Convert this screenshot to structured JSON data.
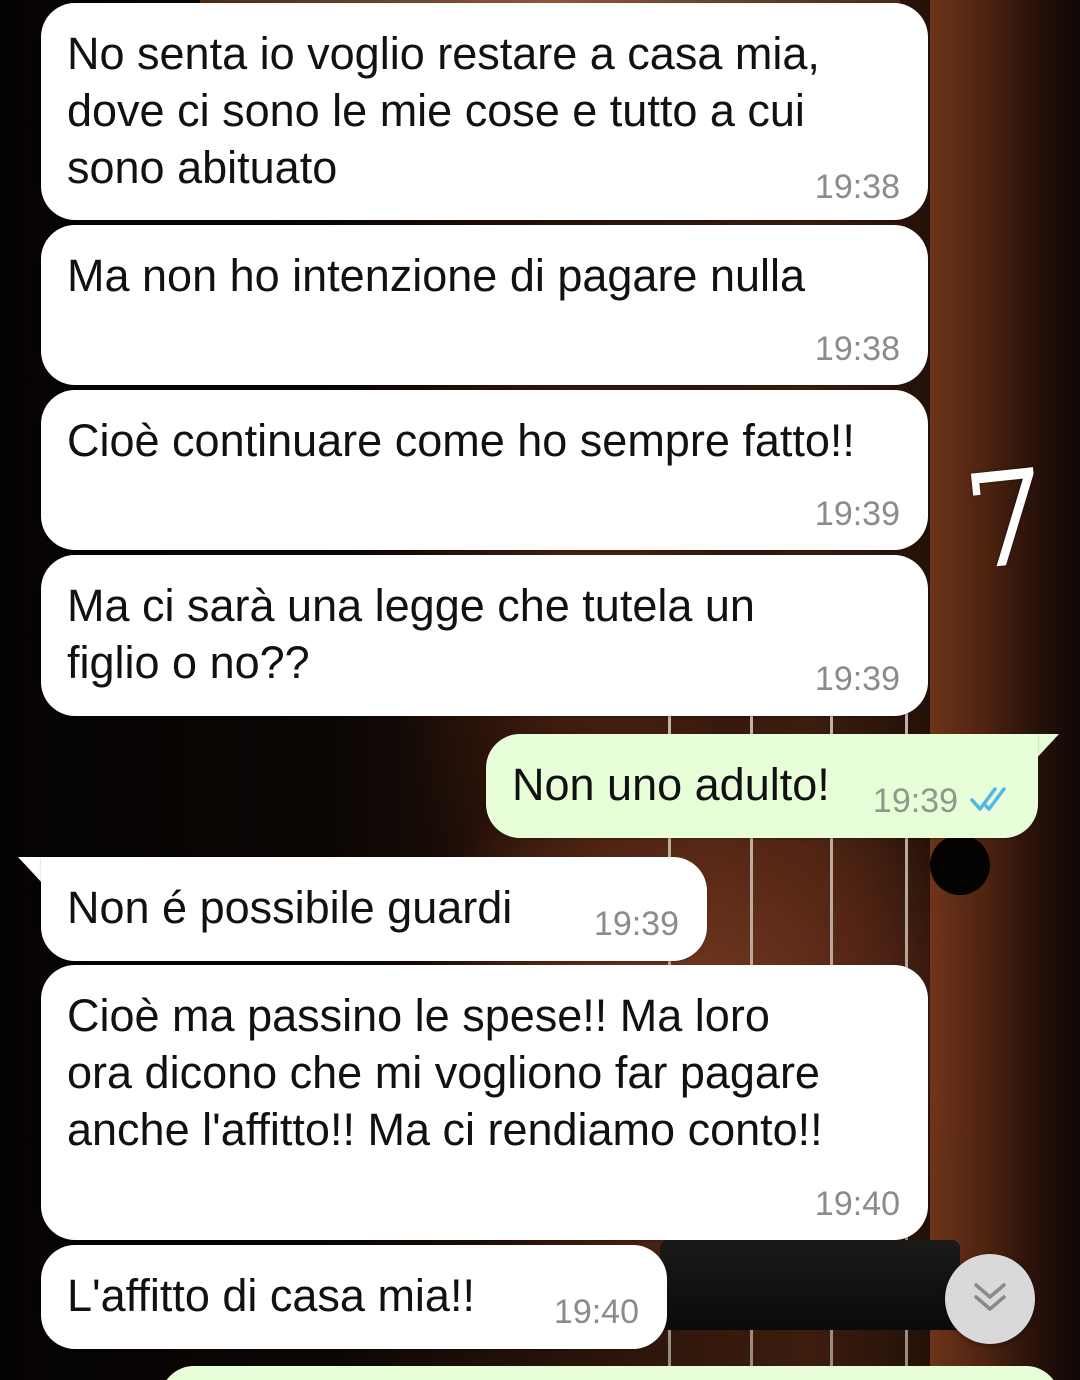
{
  "overlay": {
    "sticker_text": "7"
  },
  "messages": [
    {
      "direction": "in",
      "text": "No senta io voglio restare a casa mia,\ndove ci sono le mie cose e tutto a cui\nsono abituato",
      "time": "19:38"
    },
    {
      "direction": "in",
      "text": "Ma non ho intenzione di pagare nulla",
      "time": "19:38"
    },
    {
      "direction": "in",
      "text": "Cioè continuare come ho sempre fatto!!",
      "time": "19:39"
    },
    {
      "direction": "in",
      "text": "Ma ci sarà una legge che tutela un\nfiglio o no??",
      "time": "19:39"
    },
    {
      "direction": "out",
      "text": "Non uno adulto!",
      "time": "19:39",
      "status": "read",
      "status_color": "#4fb6ec"
    },
    {
      "direction": "in",
      "text": "Non é possibile guardi",
      "time": "19:39"
    },
    {
      "direction": "in",
      "text": "Cioè ma passino le spese!! Ma loro\nora dicono che mi vogliono far pagare\nanche l'affitto!! Ma ci rendiamo conto!!",
      "time": "19:40"
    },
    {
      "direction": "in",
      "text": "L'affitto di casa mia!!",
      "time": "19:40"
    }
  ],
  "scroll_to_bottom": {
    "icon": "double-chevron-down-icon"
  },
  "colors": {
    "incoming_bubble": "#ffffff",
    "outgoing_bubble": "#e7fed8",
    "timestamp": "#8b8b8b",
    "read_ticks": "#4fb6ec"
  }
}
